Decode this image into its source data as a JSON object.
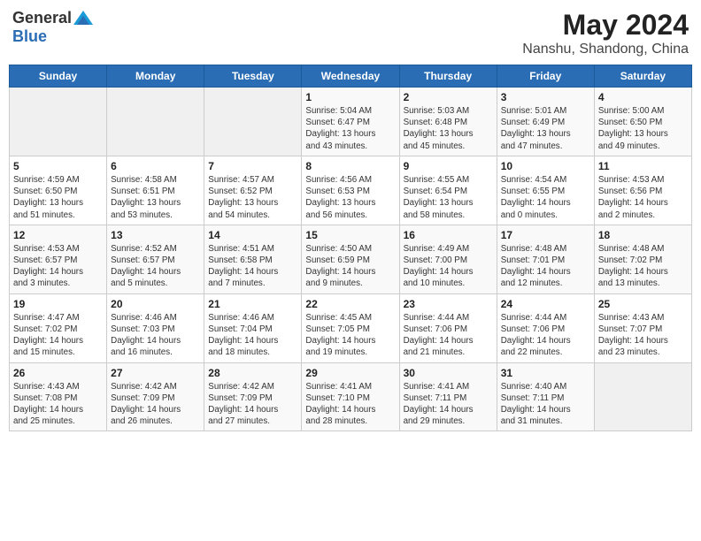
{
  "logo": {
    "general": "General",
    "blue": "Blue"
  },
  "title": "May 2024",
  "subtitle": "Nanshu, Shandong, China",
  "days": [
    "Sunday",
    "Monday",
    "Tuesday",
    "Wednesday",
    "Thursday",
    "Friday",
    "Saturday"
  ],
  "weeks": [
    [
      {
        "date": "",
        "info": ""
      },
      {
        "date": "",
        "info": ""
      },
      {
        "date": "",
        "info": ""
      },
      {
        "date": "1",
        "info": "Sunrise: 5:04 AM\nSunset: 6:47 PM\nDaylight: 13 hours\nand 43 minutes."
      },
      {
        "date": "2",
        "info": "Sunrise: 5:03 AM\nSunset: 6:48 PM\nDaylight: 13 hours\nand 45 minutes."
      },
      {
        "date": "3",
        "info": "Sunrise: 5:01 AM\nSunset: 6:49 PM\nDaylight: 13 hours\nand 47 minutes."
      },
      {
        "date": "4",
        "info": "Sunrise: 5:00 AM\nSunset: 6:50 PM\nDaylight: 13 hours\nand 49 minutes."
      }
    ],
    [
      {
        "date": "5",
        "info": "Sunrise: 4:59 AM\nSunset: 6:50 PM\nDaylight: 13 hours\nand 51 minutes."
      },
      {
        "date": "6",
        "info": "Sunrise: 4:58 AM\nSunset: 6:51 PM\nDaylight: 13 hours\nand 53 minutes."
      },
      {
        "date": "7",
        "info": "Sunrise: 4:57 AM\nSunset: 6:52 PM\nDaylight: 13 hours\nand 54 minutes."
      },
      {
        "date": "8",
        "info": "Sunrise: 4:56 AM\nSunset: 6:53 PM\nDaylight: 13 hours\nand 56 minutes."
      },
      {
        "date": "9",
        "info": "Sunrise: 4:55 AM\nSunset: 6:54 PM\nDaylight: 13 hours\nand 58 minutes."
      },
      {
        "date": "10",
        "info": "Sunrise: 4:54 AM\nSunset: 6:55 PM\nDaylight: 14 hours\nand 0 minutes."
      },
      {
        "date": "11",
        "info": "Sunrise: 4:53 AM\nSunset: 6:56 PM\nDaylight: 14 hours\nand 2 minutes."
      }
    ],
    [
      {
        "date": "12",
        "info": "Sunrise: 4:53 AM\nSunset: 6:57 PM\nDaylight: 14 hours\nand 3 minutes."
      },
      {
        "date": "13",
        "info": "Sunrise: 4:52 AM\nSunset: 6:57 PM\nDaylight: 14 hours\nand 5 minutes."
      },
      {
        "date": "14",
        "info": "Sunrise: 4:51 AM\nSunset: 6:58 PM\nDaylight: 14 hours\nand 7 minutes."
      },
      {
        "date": "15",
        "info": "Sunrise: 4:50 AM\nSunset: 6:59 PM\nDaylight: 14 hours\nand 9 minutes."
      },
      {
        "date": "16",
        "info": "Sunrise: 4:49 AM\nSunset: 7:00 PM\nDaylight: 14 hours\nand 10 minutes."
      },
      {
        "date": "17",
        "info": "Sunrise: 4:48 AM\nSunset: 7:01 PM\nDaylight: 14 hours\nand 12 minutes."
      },
      {
        "date": "18",
        "info": "Sunrise: 4:48 AM\nSunset: 7:02 PM\nDaylight: 14 hours\nand 13 minutes."
      }
    ],
    [
      {
        "date": "19",
        "info": "Sunrise: 4:47 AM\nSunset: 7:02 PM\nDaylight: 14 hours\nand 15 minutes."
      },
      {
        "date": "20",
        "info": "Sunrise: 4:46 AM\nSunset: 7:03 PM\nDaylight: 14 hours\nand 16 minutes."
      },
      {
        "date": "21",
        "info": "Sunrise: 4:46 AM\nSunset: 7:04 PM\nDaylight: 14 hours\nand 18 minutes."
      },
      {
        "date": "22",
        "info": "Sunrise: 4:45 AM\nSunset: 7:05 PM\nDaylight: 14 hours\nand 19 minutes."
      },
      {
        "date": "23",
        "info": "Sunrise: 4:44 AM\nSunset: 7:06 PM\nDaylight: 14 hours\nand 21 minutes."
      },
      {
        "date": "24",
        "info": "Sunrise: 4:44 AM\nSunset: 7:06 PM\nDaylight: 14 hours\nand 22 minutes."
      },
      {
        "date": "25",
        "info": "Sunrise: 4:43 AM\nSunset: 7:07 PM\nDaylight: 14 hours\nand 23 minutes."
      }
    ],
    [
      {
        "date": "26",
        "info": "Sunrise: 4:43 AM\nSunset: 7:08 PM\nDaylight: 14 hours\nand 25 minutes."
      },
      {
        "date": "27",
        "info": "Sunrise: 4:42 AM\nSunset: 7:09 PM\nDaylight: 14 hours\nand 26 minutes."
      },
      {
        "date": "28",
        "info": "Sunrise: 4:42 AM\nSunset: 7:09 PM\nDaylight: 14 hours\nand 27 minutes."
      },
      {
        "date": "29",
        "info": "Sunrise: 4:41 AM\nSunset: 7:10 PM\nDaylight: 14 hours\nand 28 minutes."
      },
      {
        "date": "30",
        "info": "Sunrise: 4:41 AM\nSunset: 7:11 PM\nDaylight: 14 hours\nand 29 minutes."
      },
      {
        "date": "31",
        "info": "Sunrise: 4:40 AM\nSunset: 7:11 PM\nDaylight: 14 hours\nand 31 minutes."
      },
      {
        "date": "",
        "info": ""
      }
    ]
  ]
}
